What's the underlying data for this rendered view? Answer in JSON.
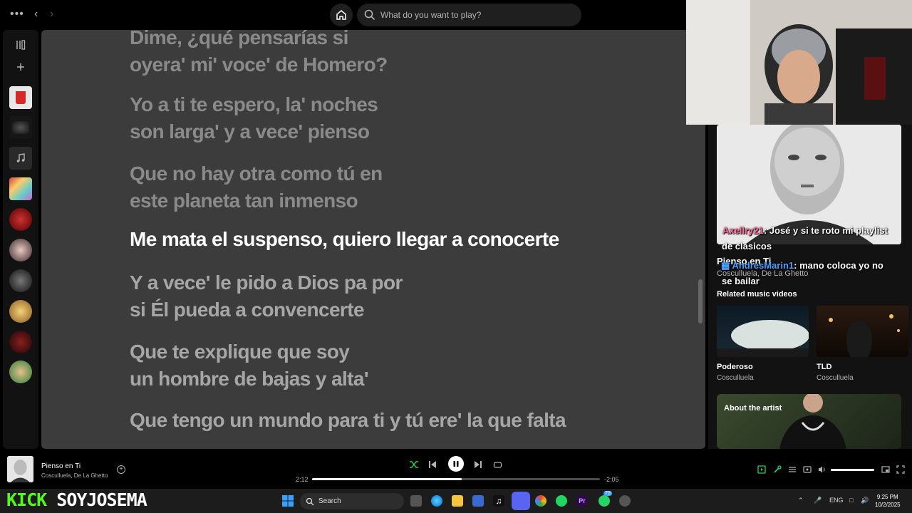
{
  "topbar": {
    "search_placeholder": "What do you want to play?"
  },
  "lyrics": [
    {
      "text": "Dime, ¿qué pensarías si",
      "state": "past"
    },
    {
      "text": "oyera' mi' voce' de Homero?",
      "state": "past"
    },
    {
      "text": "Yo a ti te espero, la' noches",
      "state": "past"
    },
    {
      "text": "son larga' y a vece' pienso",
      "state": "past"
    },
    {
      "text": "Que no hay otra como tú en",
      "state": "past"
    },
    {
      "text": "este planeta tan inmenso",
      "state": "past"
    },
    {
      "text": "Me mata el suspenso, quiero llegar a conocerte",
      "state": "active"
    },
    {
      "text": "Y a vece' le pido a Dios pa por",
      "state": "upcoming"
    },
    {
      "text": "si Él pueda a convencerte",
      "state": "upcoming"
    },
    {
      "text": "Que te explique que soy",
      "state": "upcoming"
    },
    {
      "text": "un hombre de bajas y alta'",
      "state": "upcoming"
    },
    {
      "text": "Que tengo un mundo para ti y tú ere' la que falta",
      "state": "upcoming"
    }
  ],
  "chat": [
    {
      "user": "Axellry21",
      "message": ": José y si te roto mi playlist",
      "message_cont": "de clasicos"
    },
    {
      "user": "AndresMarin1",
      "message": ": mano coloca yo no",
      "message_cont": "se bailar"
    }
  ],
  "right_panel": {
    "track_title": "Pienso en Ti",
    "track_artist": "Cosculluela, De La Ghetto",
    "related_label": "Related music videos",
    "videos": [
      {
        "title": "Poderoso",
        "artist": "Cosculluela"
      },
      {
        "title": "TLD",
        "artist": "Cosculluela"
      }
    ],
    "about_label": "About the artist"
  },
  "player": {
    "title": "Pienso en Ti",
    "artist": "Cosculluela, De La Ghetto",
    "elapsed": "2:12",
    "remaining": "-2:05",
    "progress_fraction": 0.52,
    "volume_fraction": 1.0
  },
  "taskbar": {
    "brand_k": "KICK",
    "brand_name": "SOYJOSEMA",
    "search_label": "Search",
    "badge": "70",
    "lang": "ENG",
    "time": "9:25 PM",
    "date": "10/2/2025"
  },
  "colors": {
    "spotify_green": "#1ed760",
    "kick_green": "#53fc18",
    "lyrics_bg": "#3c3c3c"
  }
}
